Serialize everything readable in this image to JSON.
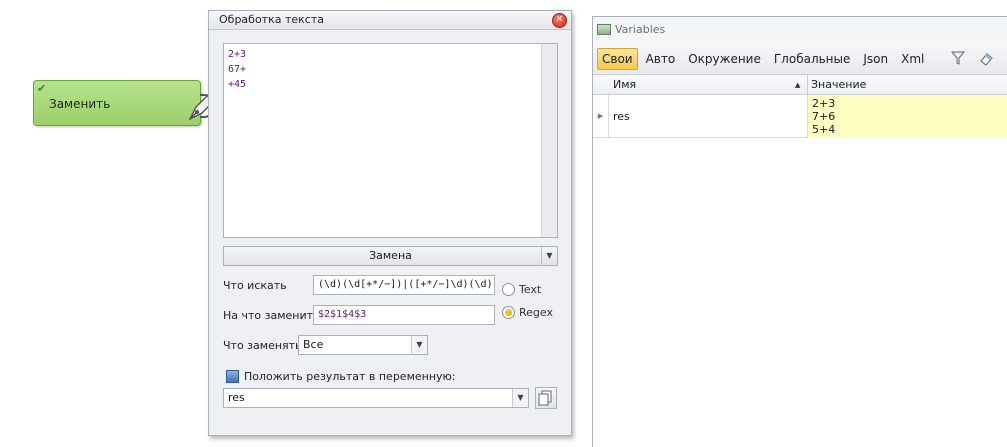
{
  "node": {
    "label": "Заменить"
  },
  "panel": {
    "title": "Обработка текста",
    "input_lines": [
      "2+3",
      "67+",
      "+45"
    ],
    "mode": "Замена",
    "find_label": "Что искать",
    "find_value": "(\\d)(\\d[+*/−])|([+*/−]\\d)(\\d)",
    "replace_label": "На что заменить",
    "replace_value": "$2$1$4$3",
    "radio_text": "Text",
    "radio_regex": "Regex",
    "what_label": "Что заменять",
    "what_value": "Все",
    "result_checkbox_label": "Положить результат в переменную:",
    "result_var": "res"
  },
  "vars": {
    "title": "Variables",
    "tabs": [
      "Свои",
      "Авто",
      "Окружение",
      "Глобальные",
      "Json",
      "Xml"
    ],
    "columns": {
      "name": "Имя",
      "value": "Значение"
    },
    "row": {
      "name": "res",
      "value_lines": [
        "2+3",
        "7+6",
        "5+4"
      ]
    },
    "colors": {
      "active_tab": "#f6c74a",
      "value_cell": "#ffffc4"
    }
  },
  "icons": {
    "filter": "filter-icon",
    "eraser": "eraser-icon",
    "add": "add-icon",
    "delete": "delete-icon",
    "pen": "pen-icon"
  }
}
